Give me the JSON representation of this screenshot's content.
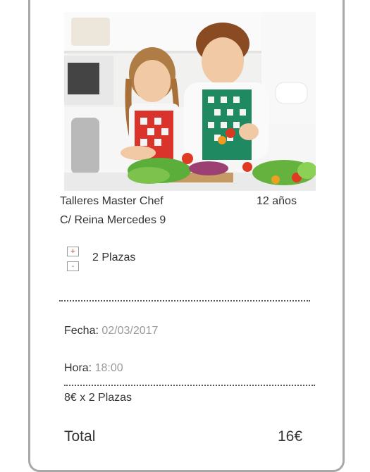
{
  "workshop": {
    "name": "Talleres Master Chef",
    "age": "12 años",
    "address": "C/ Reina Mercedes 9"
  },
  "booking": {
    "plus_symbol": "+",
    "minus_symbol": "-",
    "seats_label": "2 Plazas",
    "date_label": "Fecha:",
    "date_value": "02/03/2017",
    "time_label": "Hora:",
    "time_value": "18:00",
    "price_summary": "8€ x 2 Plazas",
    "total_label": "Total",
    "total_value": "16€"
  }
}
